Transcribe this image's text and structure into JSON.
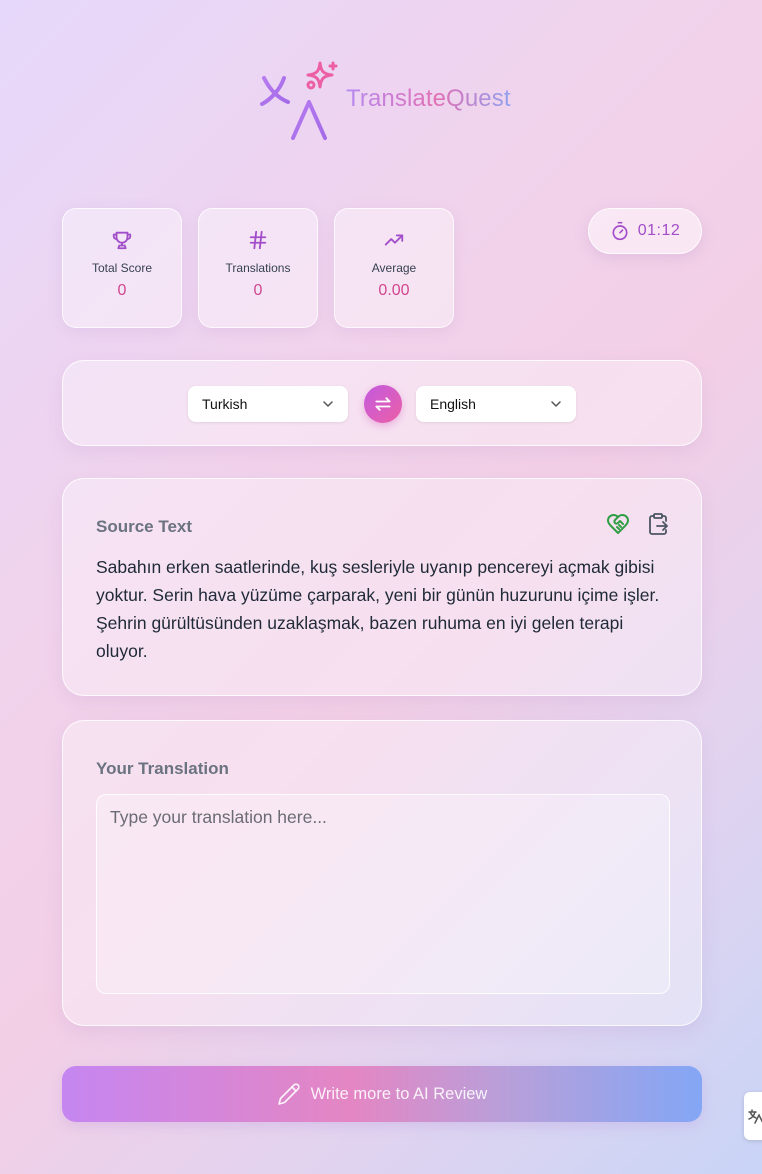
{
  "app": {
    "name": "TranslateQuest",
    "brand_colors": {
      "purple": "#b58af2",
      "pink": "#e26fb4",
      "blue": "#8fa2f0"
    }
  },
  "stats": [
    {
      "icon": "trophy-icon",
      "label": "Total Score",
      "value": "0"
    },
    {
      "icon": "hash-icon",
      "label": "Translations",
      "value": "0"
    },
    {
      "icon": "trending-up-icon",
      "label": "Average",
      "value": "0.00"
    }
  ],
  "timer": {
    "icon": "stopwatch-icon",
    "value": "01:12"
  },
  "languages": {
    "source": "Turkish",
    "target": "English",
    "swap_icon": "swap-arrows-icon"
  },
  "source_panel": {
    "title": "Source Text",
    "text": "Sabahın erken saatlerinde, kuş sesleriyle uyanıp pencereyi açmak gibisi yoktur. Serin hava yüzüme çarparak, yeni bir günün huzurunu içime işler. Şehrin gürültüsünden uzaklaşmak, bazen ruhuma en iyi gelen terapi oluyor.",
    "actions": [
      "heart-handshake-icon",
      "clipboard-paste-icon"
    ]
  },
  "translation_panel": {
    "title": "Your Translation",
    "value": "",
    "placeholder": "Type your translation here..."
  },
  "review_button": {
    "icon": "pencil-icon",
    "label": "Write more to AI Review"
  }
}
